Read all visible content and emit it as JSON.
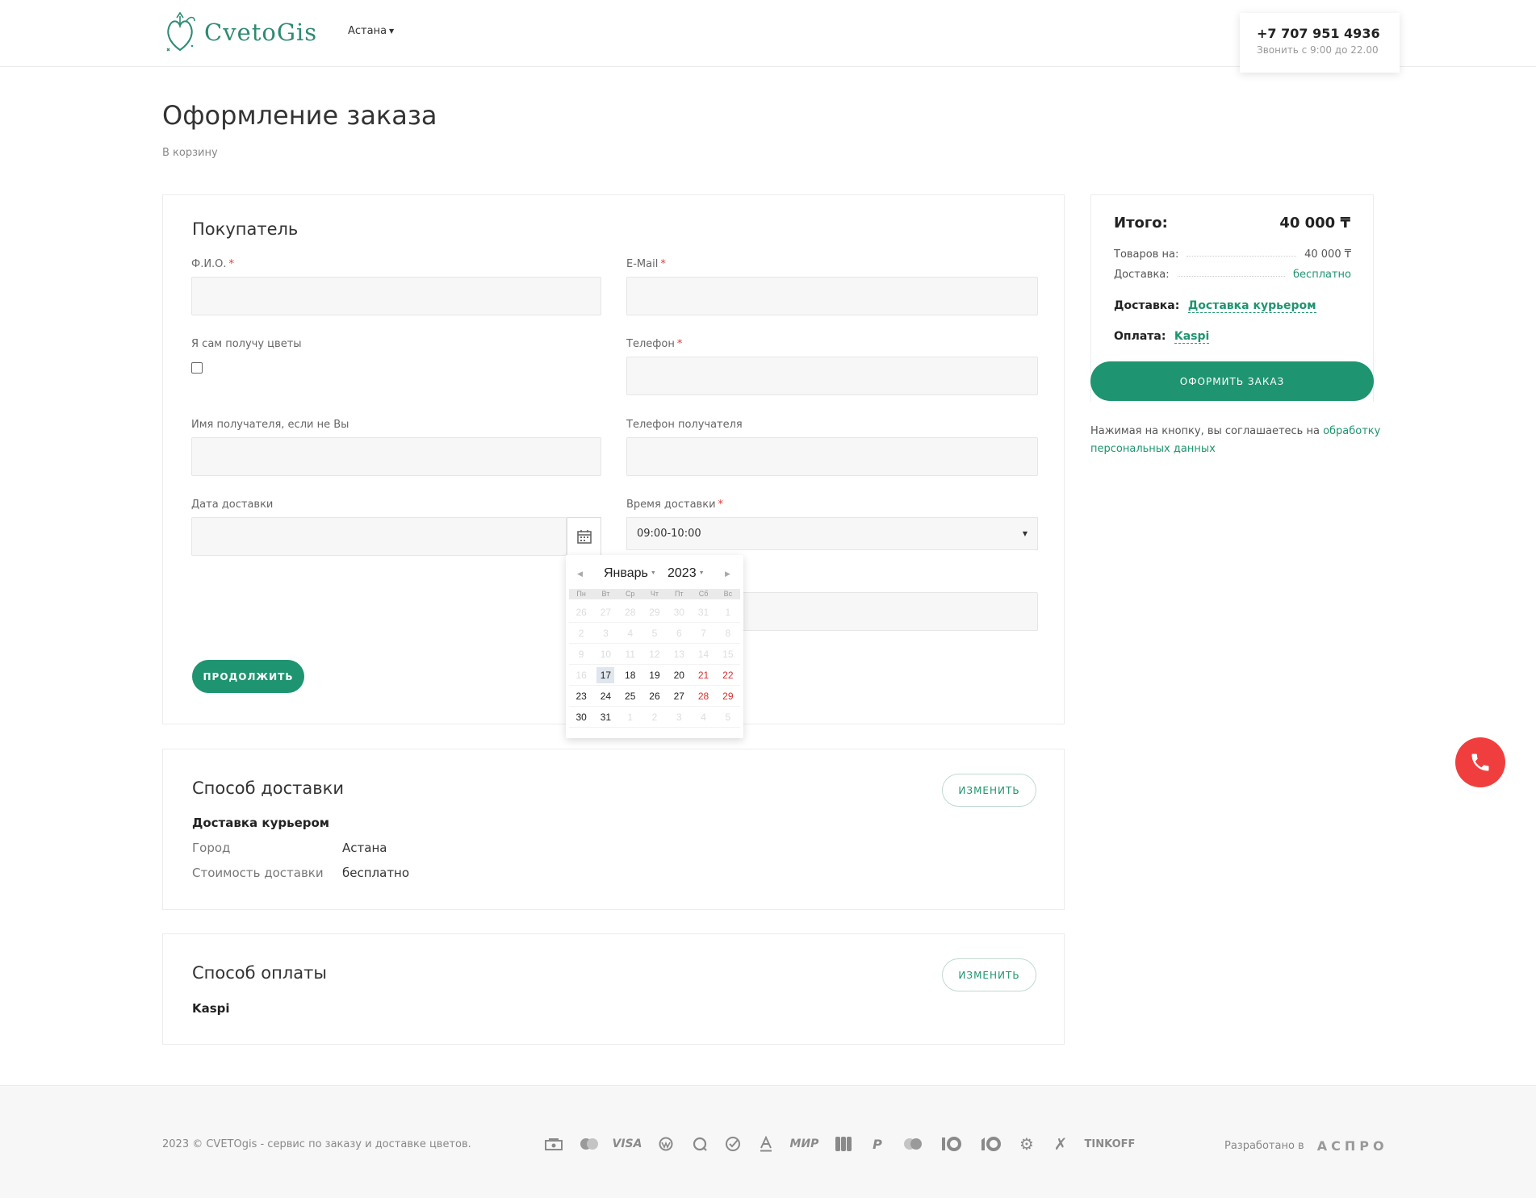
{
  "header": {
    "logo_text": "CvetoGis",
    "city": "Астана",
    "phone": "+7 707 951 4936",
    "phone_hours": "Звонить с 9:00 до 22.00"
  },
  "page": {
    "title": "Оформление заказа",
    "back_link": "В корзину"
  },
  "buyer": {
    "title": "Покупатель",
    "fio_label": "Ф.И.О.",
    "email_label": "E-Mail",
    "self_pickup_label": "Я сам получу цветы",
    "phone_label": "Телефон",
    "recipient_name_label": "Имя получателя, если не Вы",
    "recipient_phone_label": "Телефон получателя",
    "delivery_date_label": "Дата доставки",
    "delivery_time_label": "Время доставки",
    "delivery_time_value": "09:00-10:00",
    "required_mark": "*",
    "continue_button": "Продолжить"
  },
  "calendar": {
    "month": "Январь",
    "year": "2023",
    "weekdays": [
      "Пн",
      "Вт",
      "Ср",
      "Чт",
      "Пт",
      "Сб",
      "Вс"
    ],
    "weeks": [
      [
        {
          "d": "26",
          "s": "muted"
        },
        {
          "d": "27",
          "s": "muted"
        },
        {
          "d": "28",
          "s": "muted"
        },
        {
          "d": "29",
          "s": "muted"
        },
        {
          "d": "30",
          "s": "muted"
        },
        {
          "d": "31",
          "s": "muted"
        },
        {
          "d": "1",
          "s": "muted"
        }
      ],
      [
        {
          "d": "2",
          "s": "muted"
        },
        {
          "d": "3",
          "s": "muted"
        },
        {
          "d": "4",
          "s": "muted"
        },
        {
          "d": "5",
          "s": "muted"
        },
        {
          "d": "6",
          "s": "muted"
        },
        {
          "d": "7",
          "s": "muted"
        },
        {
          "d": "8",
          "s": "muted"
        }
      ],
      [
        {
          "d": "9",
          "s": "muted"
        },
        {
          "d": "10",
          "s": "muted"
        },
        {
          "d": "11",
          "s": "muted"
        },
        {
          "d": "12",
          "s": "muted"
        },
        {
          "d": "13",
          "s": "muted"
        },
        {
          "d": "14",
          "s": "muted"
        },
        {
          "d": "15",
          "s": "muted"
        }
      ],
      [
        {
          "d": "16",
          "s": "muted"
        },
        {
          "d": "17",
          "s": "today"
        },
        {
          "d": "18",
          "s": ""
        },
        {
          "d": "19",
          "s": ""
        },
        {
          "d": "20",
          "s": ""
        },
        {
          "d": "21",
          "s": "wknd"
        },
        {
          "d": "22",
          "s": "wknd"
        }
      ],
      [
        {
          "d": "23",
          "s": ""
        },
        {
          "d": "24",
          "s": ""
        },
        {
          "d": "25",
          "s": ""
        },
        {
          "d": "26",
          "s": ""
        },
        {
          "d": "27",
          "s": ""
        },
        {
          "d": "28",
          "s": "wknd"
        },
        {
          "d": "29",
          "s": "wknd"
        }
      ],
      [
        {
          "d": "30",
          "s": ""
        },
        {
          "d": "31",
          "s": ""
        },
        {
          "d": "1",
          "s": "muted"
        },
        {
          "d": "2",
          "s": "muted"
        },
        {
          "d": "3",
          "s": "muted"
        },
        {
          "d": "4",
          "s": "muted"
        },
        {
          "d": "5",
          "s": "muted"
        }
      ]
    ]
  },
  "delivery": {
    "title": "Способ доставки",
    "change_button": "Изменить",
    "method": "Доставка курьером",
    "city_label": "Город",
    "city_value": "Астана",
    "cost_label": "Стоимость доставки",
    "cost_value": "бесплатно"
  },
  "payment": {
    "title": "Способ оплаты",
    "change_button": "Изменить",
    "method": "Kaspi"
  },
  "summary": {
    "total_label": "Итого:",
    "total_value": "40 000 ₸",
    "goods_label": "Товаров на:",
    "goods_value": "40 000 ₸",
    "delivery_label": "Доставка:",
    "delivery_value": "бесплатно",
    "delivery_method_label": "Доставка:",
    "delivery_method_value": "Доставка курьером",
    "payment_method_label": "Оплата:",
    "payment_method_value": "Kaspi",
    "order_button": "Оформить заказ",
    "agree_text": "Нажимая на кнопку, вы соглашаетесь на ",
    "agree_link": "обработку персональных данных"
  },
  "footer": {
    "copyright": "2023 © CVETOgis - сервис по заказу и доставке цветов.",
    "payment_icons": [
      "cash-icon",
      "mastercard-icon",
      "visa-icon",
      "webmoney-icon",
      "qiwi-icon",
      "sberbank-icon",
      "alfabank-icon",
      "mir-icon",
      "jcb-icon",
      "paypal-icon",
      "maestro-icon",
      "yoomoney-icon",
      "yookassa-icon",
      "settings-gear-icon",
      "x-pay-icon",
      "tinkoff-icon"
    ],
    "visa_text": "VISA",
    "mir_text": "МИР",
    "tinkoff_text": "TINKOFF",
    "developed_by": "Разработано в",
    "developer": "АСПРО"
  }
}
